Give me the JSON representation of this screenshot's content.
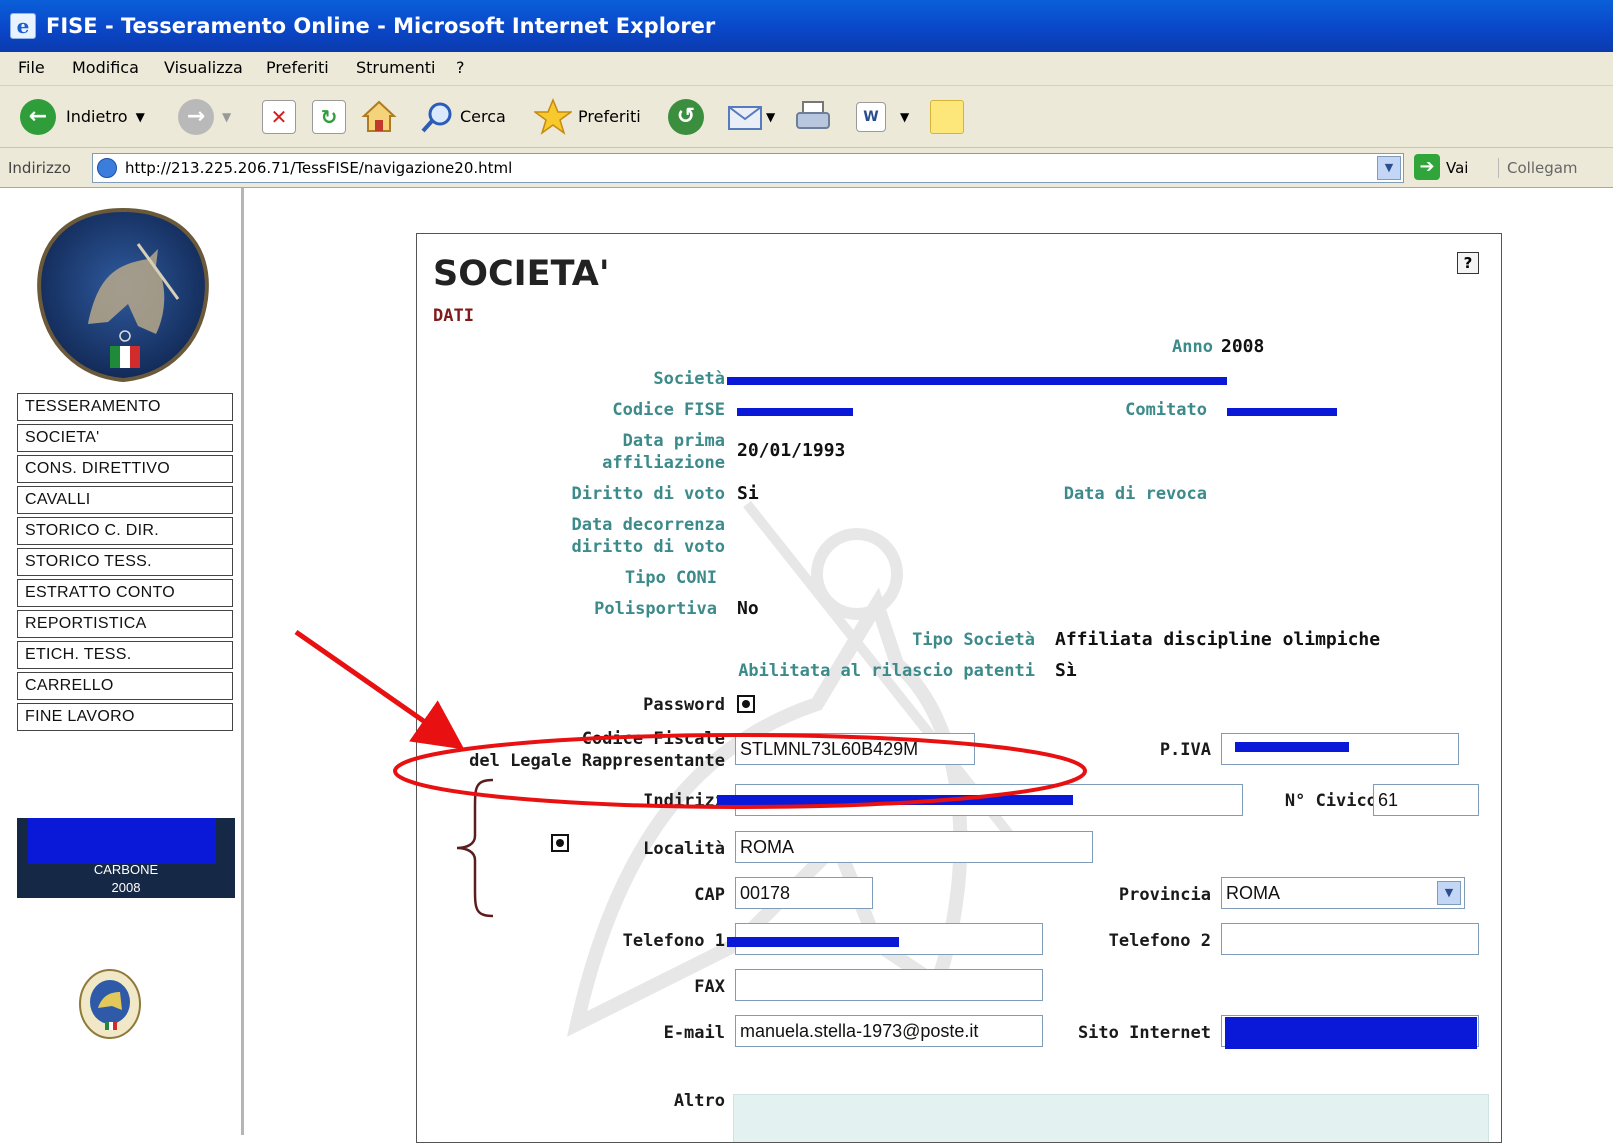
{
  "window": {
    "title": "FISE - Tesseramento Online - Microsoft Internet Explorer"
  },
  "menu": {
    "items": [
      "File",
      "Modifica",
      "Visualizza",
      "Preferiti",
      "Strumenti",
      "?"
    ]
  },
  "toolbar": {
    "back_label": "Indietro",
    "search_label": "Cerca",
    "favorites_label": "Preferiti"
  },
  "address": {
    "label": "Indirizzo",
    "url": "http://213.225.206.71/TessFISE/navigazione20.html",
    "go_label": "Vai",
    "links_label": "Collegam"
  },
  "nav": {
    "items": [
      "TESSERAMENTO",
      "SOCIETA'",
      "CONS. DIRETTIVO",
      "CAVALLI",
      "STORICO C. DIR.",
      "STORICO TESS.",
      "ESTRATTO CONTO",
      "REPORTISTICA",
      "ETICH. TESS.",
      "CARRELLO",
      "FINE LAVORO"
    ]
  },
  "club": {
    "name": "CARBONE",
    "year": "2008"
  },
  "form": {
    "title": "SOCIETA'",
    "subtitle": "DATI",
    "help": "?",
    "anno_label": "Anno",
    "anno_value": "2008",
    "societa_label": "Società",
    "codice_fise_label": "Codice FISE",
    "comitato_label": "Comitato",
    "data_prima_label_1": "Data prima",
    "data_prima_label_2": "affiliazione",
    "data_prima_value": "20/01/1993",
    "diritto_voto_label": "Diritto di voto",
    "diritto_voto_value": "Si",
    "data_revoca_label": "Data di revoca",
    "data_decorrenza_label_1": "Data decorrenza",
    "data_decorrenza_label_2": "diritto di voto",
    "tipo_coni_label": "Tipo CONI",
    "polisportiva_label": "Polisportiva",
    "polisportiva_value": "No",
    "tipo_societa_label": "Tipo Società",
    "tipo_societa_value": "Affiliata discipline olimpiche",
    "abilitata_label": "Abilitata al rilascio patenti",
    "abilitata_value": "Sì",
    "password_label": "Password",
    "codice_fiscale_label_1": "Codice Fiscale",
    "codice_fiscale_label_2": "del Legale Rappresentante",
    "codice_fiscale_value": "STLMNL73L60B429M",
    "piva_label": "P.IVA",
    "indirizzo_label": "Indirizz",
    "civico_label": "N° Civico",
    "civico_value": "61",
    "localita_label": "Località",
    "localita_value": "ROMA",
    "cap_label": "CAP",
    "cap_value": "00178",
    "provincia_label": "Provincia",
    "provincia_value": "ROMA",
    "telefono1_label": "Telefono 1",
    "telefono2_label": "Telefono 2",
    "telefono2_value": "",
    "fax_label": "FAX",
    "fax_value": "",
    "email_label": "E-mail",
    "email_value": "manuela.stella-1973@poste.it",
    "sito_label": "Sito Internet",
    "altro_label": "Altro"
  },
  "colors": {
    "label_teal": "#3c8a8a",
    "redaction_blue": "#0a18d8",
    "annotation_red": "#e81010",
    "subtitle_maroon": "#7f1b1b",
    "xp_blue": "#0a47c9"
  }
}
